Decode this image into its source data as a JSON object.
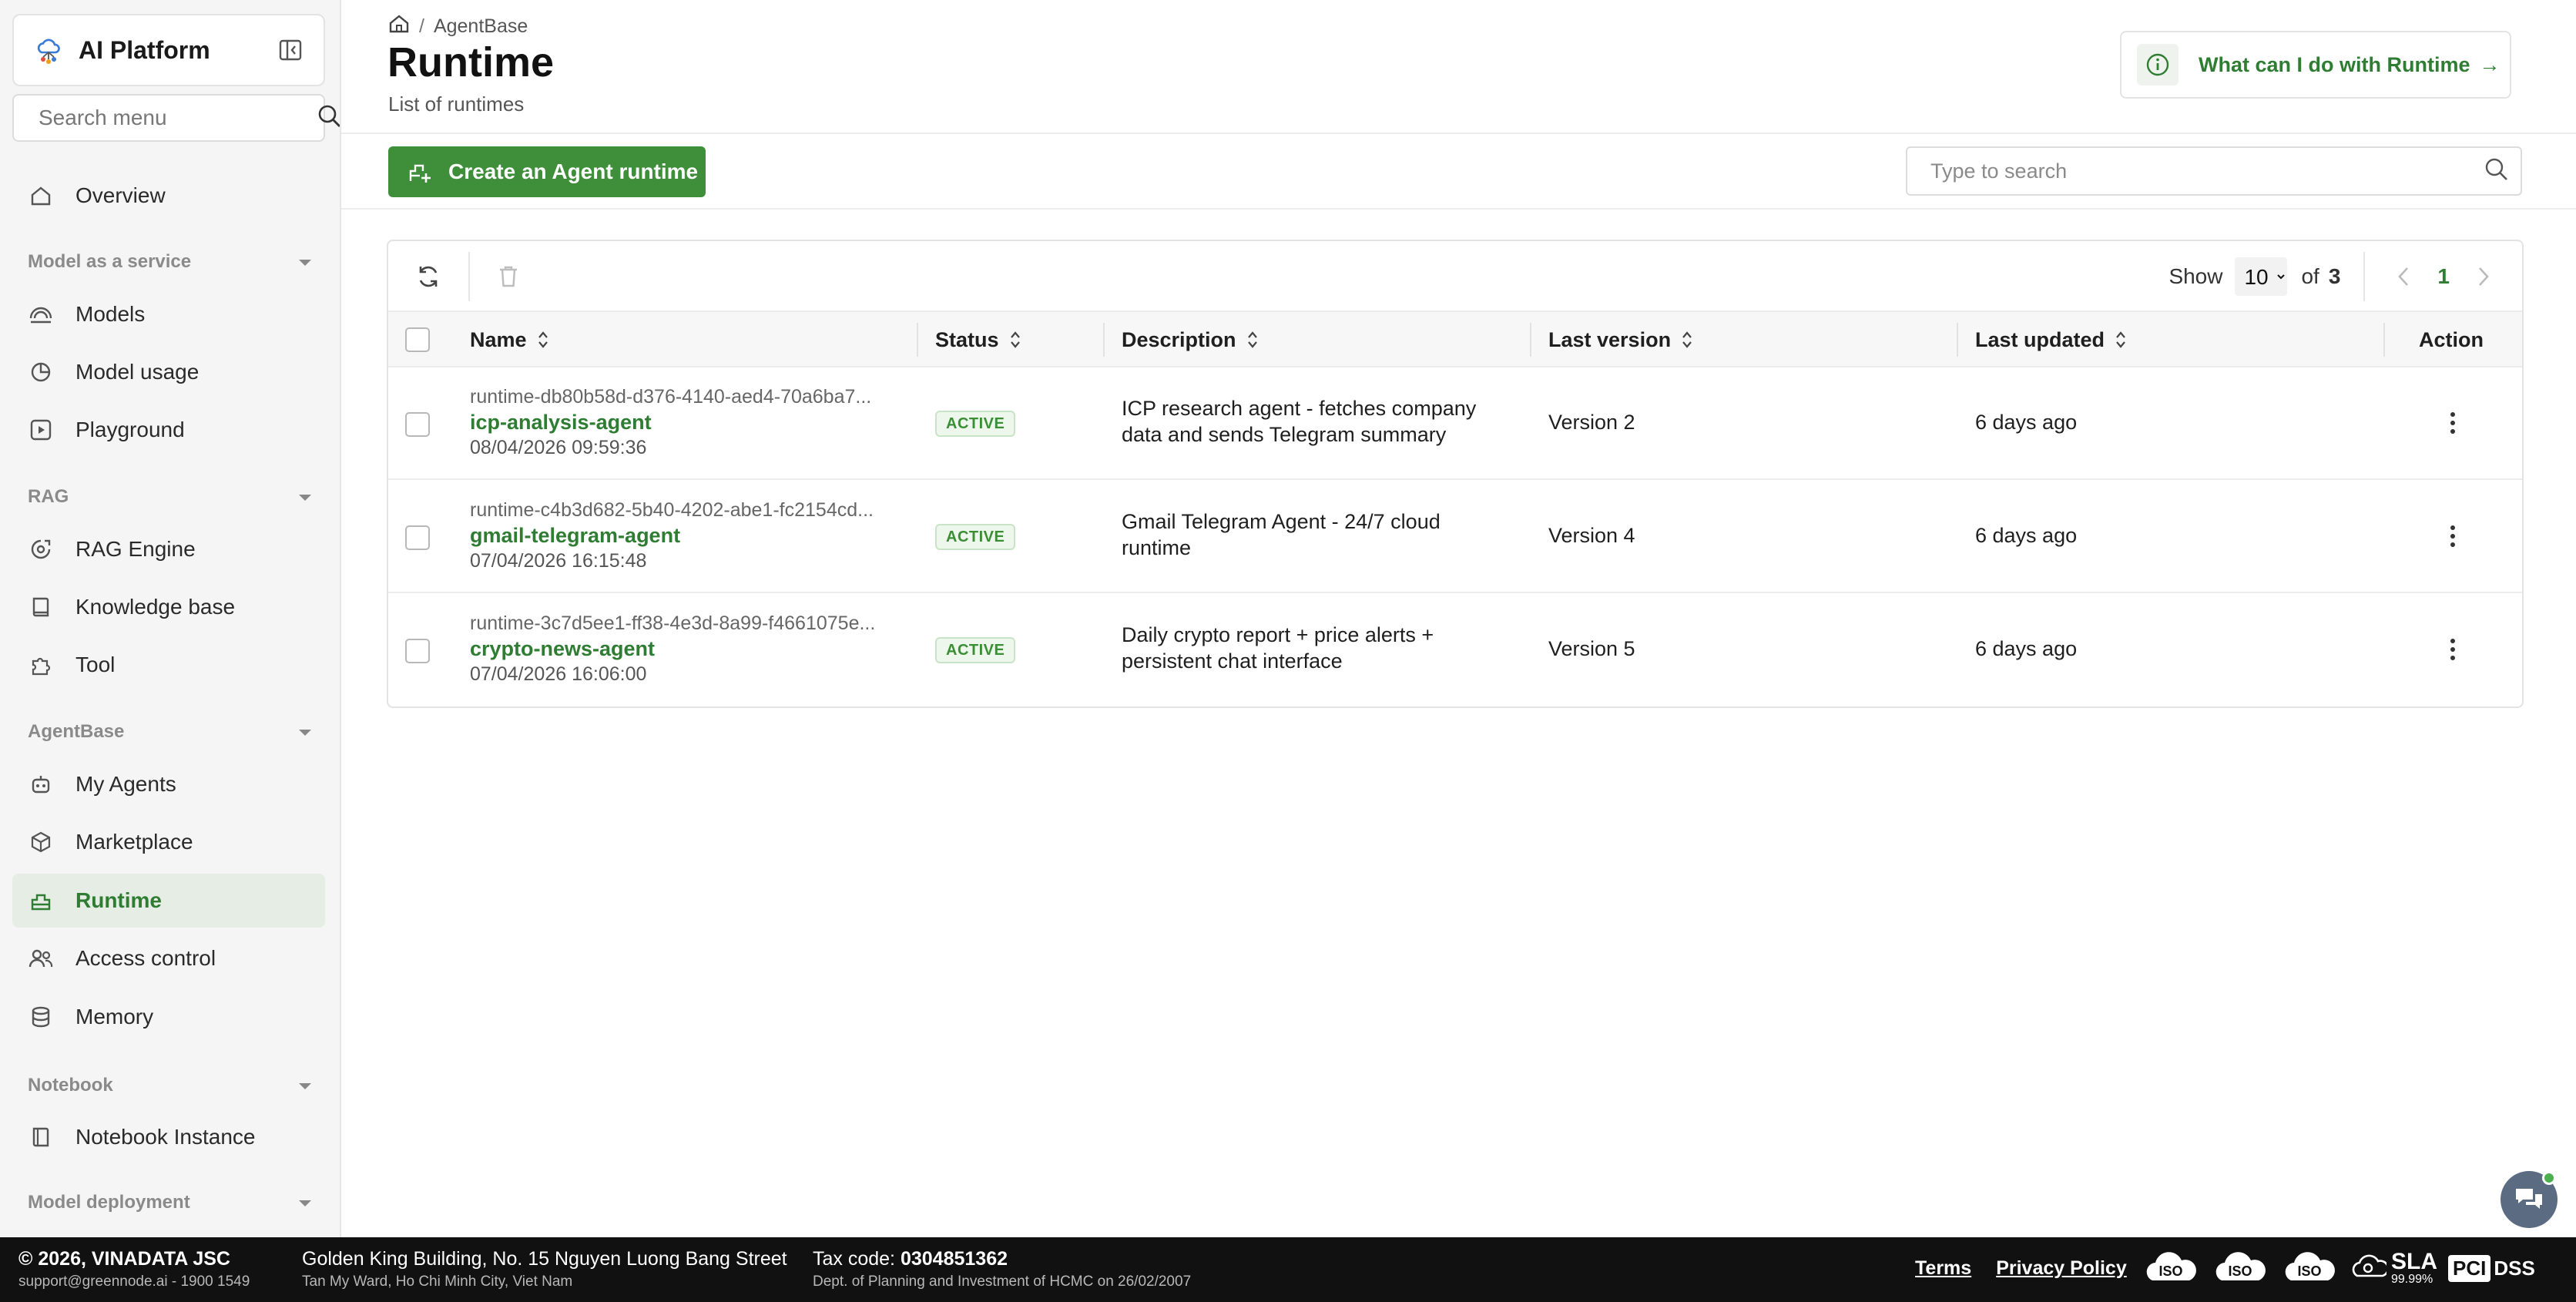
{
  "sidebar": {
    "brand": "AI Platform",
    "search_placeholder": "Search menu",
    "overview": "Overview",
    "sections": {
      "maas": "Model as a service",
      "rag": "RAG",
      "agentbase": "AgentBase",
      "notebook": "Notebook",
      "deployment": "Model deployment"
    },
    "items": {
      "models": "Models",
      "model_usage": "Model usage",
      "playground": "Playground",
      "rag_engine": "RAG Engine",
      "knowledge_base": "Knowledge base",
      "tool": "Tool",
      "my_agents": "My Agents",
      "marketplace": "Marketplace",
      "runtime": "Runtime",
      "access_control": "Access control",
      "memory": "Memory",
      "notebook_instance": "Notebook Instance"
    }
  },
  "header": {
    "breadcrumb": "AgentBase",
    "breadcrumb_sep": "/",
    "title": "Runtime",
    "subtitle": "List of runtimes",
    "help": "What can I do with Runtime",
    "help_arrow": "→"
  },
  "toolbar": {
    "create_label": "Create an Agent runtime",
    "search_placeholder": "Type to search"
  },
  "pager": {
    "show_label": "Show",
    "page_size": "10",
    "of_label": "of",
    "total": "3",
    "current_page": "1"
  },
  "table": {
    "columns": {
      "name": "Name",
      "status": "Status",
      "description": "Description",
      "last_version": "Last version",
      "last_updated": "Last updated",
      "action": "Action"
    },
    "rows": [
      {
        "id": "runtime-db80b58d-d376-4140-aed4-70a6ba7...",
        "name": "icp-analysis-agent",
        "created": "08/04/2026 09:59:36",
        "status": "ACTIVE",
        "desc1": "ICP research agent - fetches company",
        "desc2": "data and sends Telegram summary",
        "version": "Version 2",
        "updated": "6 days ago"
      },
      {
        "id": "runtime-c4b3d682-5b40-4202-abe1-fc2154cd...",
        "name": "gmail-telegram-agent",
        "created": "07/04/2026 16:15:48",
        "status": "ACTIVE",
        "desc1": "Gmail Telegram Agent - 24/7 cloud",
        "desc2": "runtime",
        "version": "Version 4",
        "updated": "6 days ago"
      },
      {
        "id": "runtime-3c7d5ee1-ff38-4e3d-8a99-f4661075e...",
        "name": "crypto-news-agent",
        "created": "07/04/2026 16:06:00",
        "status": "ACTIVE",
        "desc1": "Daily crypto report + price alerts +",
        "desc2": "persistent chat interface",
        "version": "Version 5",
        "updated": "6 days ago"
      }
    ]
  },
  "footer": {
    "copyright": "© 2026, VINADATA JSC",
    "support": "support@greennode.ai - 1900 1549",
    "address": "Golden King Building, No. 15 Nguyen Luong Bang Street",
    "address2": "Tan My Ward, Ho Chi Minh City, Viet Nam",
    "tax_label": "Tax code:",
    "tax_code": "0304851362",
    "tax_note": "Dept. of Planning and Investment of HCMC on 26/02/2007",
    "terms": "Terms",
    "privacy": "Privacy Policy",
    "iso": "ISO",
    "sla": "SLA",
    "sla_value": "99.99%",
    "pci": "PCI",
    "dss": "DSS"
  },
  "colors": {
    "brand_green": "#2e7d32",
    "primary_button": "#3e8e3a",
    "active_nav_bg": "#e6ede5",
    "footer_bg": "#111111"
  },
  "icons": {
    "brand": "cloud-network-icon",
    "collapse": "sidebar-collapse-icon",
    "search": "search-icon",
    "refresh": "refresh-icon",
    "delete": "trash-icon",
    "chat": "chat-bubble-icon"
  }
}
